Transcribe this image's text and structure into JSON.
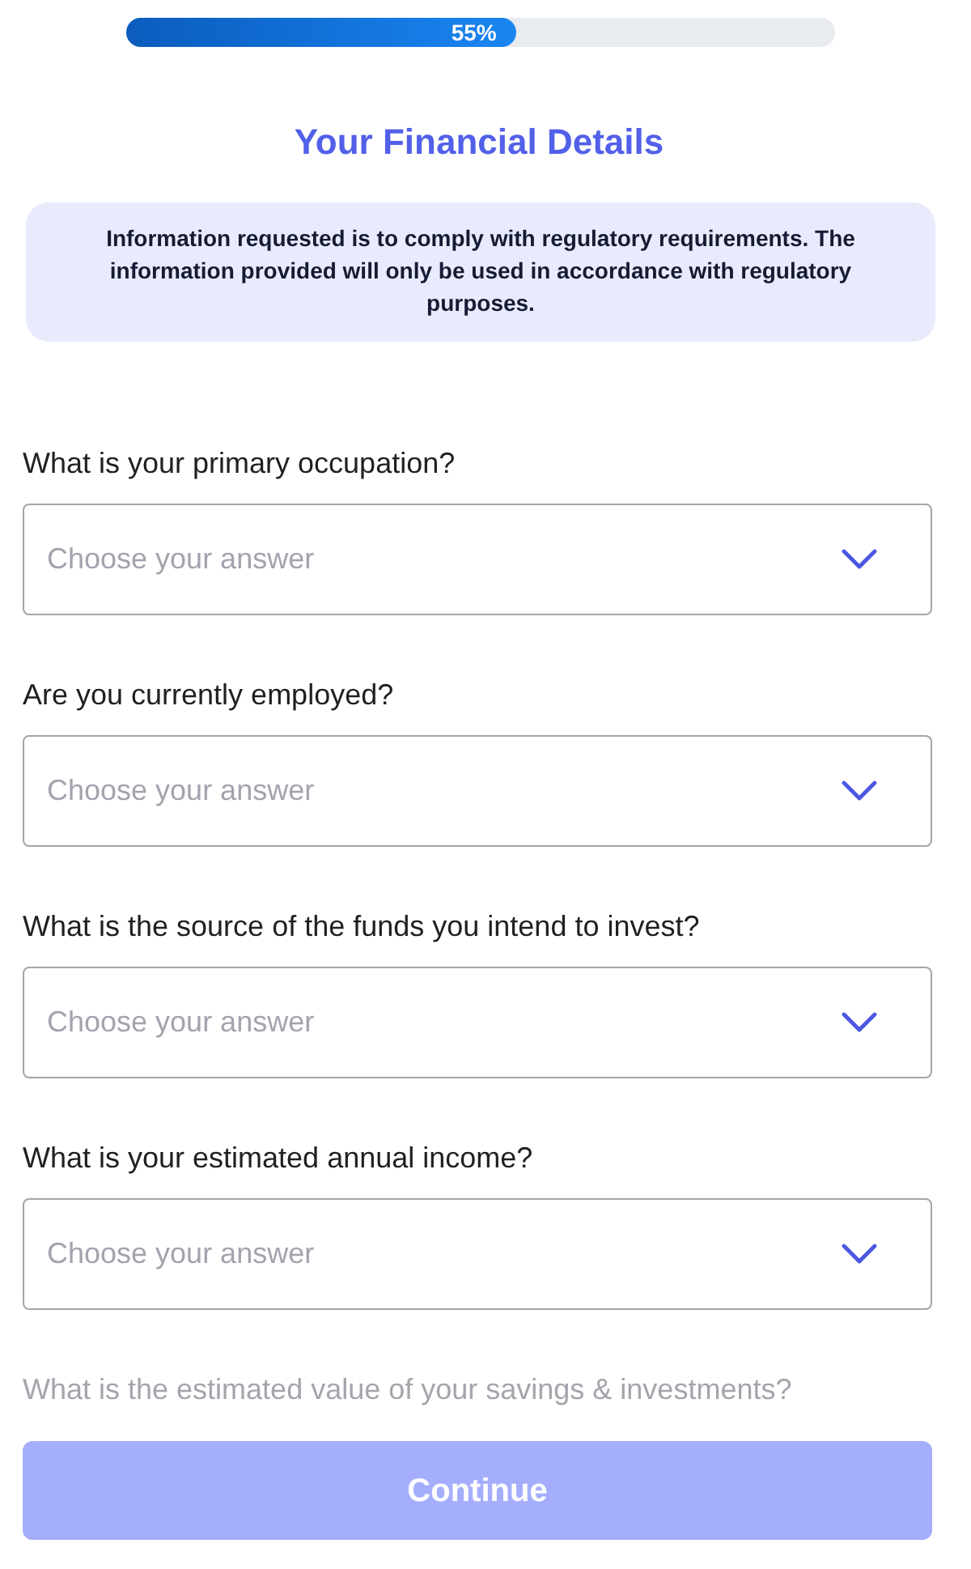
{
  "progress": {
    "level": 0.55,
    "label": "55%"
  },
  "title": "Your Financial Details",
  "notice": "Information requested is to comply with regulatory requirements. The information provided will only be used in accordance with regulatory purposes.",
  "questions": [
    {
      "label": "What is your primary occupation?",
      "placeholder": "Choose your answer",
      "faded": false
    },
    {
      "label": "Are you currently employed?",
      "placeholder": "Choose your answer",
      "faded": false
    },
    {
      "label": "What is the source of the funds you intend to invest?",
      "placeholder": "Choose your answer",
      "faded": false
    },
    {
      "label": "What is your estimated annual income?",
      "placeholder": "Choose your answer",
      "faded": false
    },
    {
      "label": "What is the estimated value of your savings & investments?",
      "faded": true
    }
  ],
  "continue_button": {
    "label": "Continue",
    "disabled": true
  }
}
